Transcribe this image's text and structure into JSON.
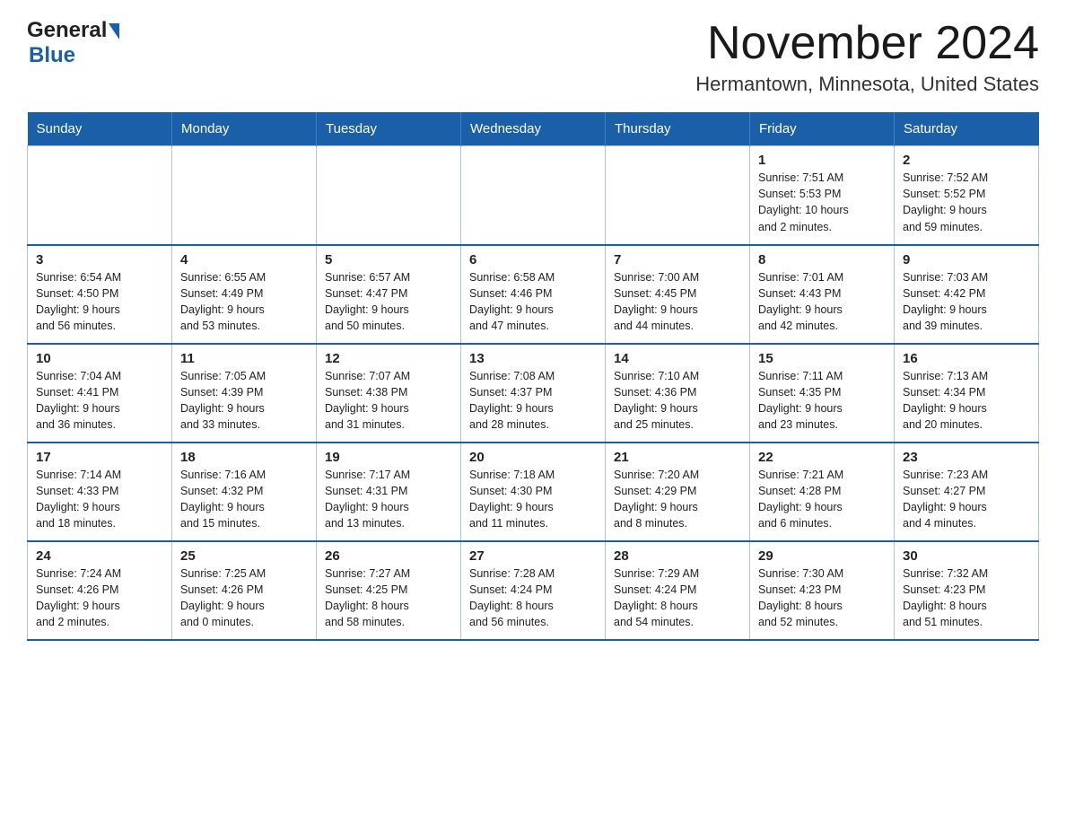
{
  "logo": {
    "general": "General",
    "blue": "Blue"
  },
  "title": "November 2024",
  "location": "Hermantown, Minnesota, United States",
  "days_of_week": [
    "Sunday",
    "Monday",
    "Tuesday",
    "Wednesday",
    "Thursday",
    "Friday",
    "Saturday"
  ],
  "weeks": [
    [
      {
        "day": "",
        "info": ""
      },
      {
        "day": "",
        "info": ""
      },
      {
        "day": "",
        "info": ""
      },
      {
        "day": "",
        "info": ""
      },
      {
        "day": "",
        "info": ""
      },
      {
        "day": "1",
        "info": "Sunrise: 7:51 AM\nSunset: 5:53 PM\nDaylight: 10 hours\nand 2 minutes."
      },
      {
        "day": "2",
        "info": "Sunrise: 7:52 AM\nSunset: 5:52 PM\nDaylight: 9 hours\nand 59 minutes."
      }
    ],
    [
      {
        "day": "3",
        "info": "Sunrise: 6:54 AM\nSunset: 4:50 PM\nDaylight: 9 hours\nand 56 minutes."
      },
      {
        "day": "4",
        "info": "Sunrise: 6:55 AM\nSunset: 4:49 PM\nDaylight: 9 hours\nand 53 minutes."
      },
      {
        "day": "5",
        "info": "Sunrise: 6:57 AM\nSunset: 4:47 PM\nDaylight: 9 hours\nand 50 minutes."
      },
      {
        "day": "6",
        "info": "Sunrise: 6:58 AM\nSunset: 4:46 PM\nDaylight: 9 hours\nand 47 minutes."
      },
      {
        "day": "7",
        "info": "Sunrise: 7:00 AM\nSunset: 4:45 PM\nDaylight: 9 hours\nand 44 minutes."
      },
      {
        "day": "8",
        "info": "Sunrise: 7:01 AM\nSunset: 4:43 PM\nDaylight: 9 hours\nand 42 minutes."
      },
      {
        "day": "9",
        "info": "Sunrise: 7:03 AM\nSunset: 4:42 PM\nDaylight: 9 hours\nand 39 minutes."
      }
    ],
    [
      {
        "day": "10",
        "info": "Sunrise: 7:04 AM\nSunset: 4:41 PM\nDaylight: 9 hours\nand 36 minutes."
      },
      {
        "day": "11",
        "info": "Sunrise: 7:05 AM\nSunset: 4:39 PM\nDaylight: 9 hours\nand 33 minutes."
      },
      {
        "day": "12",
        "info": "Sunrise: 7:07 AM\nSunset: 4:38 PM\nDaylight: 9 hours\nand 31 minutes."
      },
      {
        "day": "13",
        "info": "Sunrise: 7:08 AM\nSunset: 4:37 PM\nDaylight: 9 hours\nand 28 minutes."
      },
      {
        "day": "14",
        "info": "Sunrise: 7:10 AM\nSunset: 4:36 PM\nDaylight: 9 hours\nand 25 minutes."
      },
      {
        "day": "15",
        "info": "Sunrise: 7:11 AM\nSunset: 4:35 PM\nDaylight: 9 hours\nand 23 minutes."
      },
      {
        "day": "16",
        "info": "Sunrise: 7:13 AM\nSunset: 4:34 PM\nDaylight: 9 hours\nand 20 minutes."
      }
    ],
    [
      {
        "day": "17",
        "info": "Sunrise: 7:14 AM\nSunset: 4:33 PM\nDaylight: 9 hours\nand 18 minutes."
      },
      {
        "day": "18",
        "info": "Sunrise: 7:16 AM\nSunset: 4:32 PM\nDaylight: 9 hours\nand 15 minutes."
      },
      {
        "day": "19",
        "info": "Sunrise: 7:17 AM\nSunset: 4:31 PM\nDaylight: 9 hours\nand 13 minutes."
      },
      {
        "day": "20",
        "info": "Sunrise: 7:18 AM\nSunset: 4:30 PM\nDaylight: 9 hours\nand 11 minutes."
      },
      {
        "day": "21",
        "info": "Sunrise: 7:20 AM\nSunset: 4:29 PM\nDaylight: 9 hours\nand 8 minutes."
      },
      {
        "day": "22",
        "info": "Sunrise: 7:21 AM\nSunset: 4:28 PM\nDaylight: 9 hours\nand 6 minutes."
      },
      {
        "day": "23",
        "info": "Sunrise: 7:23 AM\nSunset: 4:27 PM\nDaylight: 9 hours\nand 4 minutes."
      }
    ],
    [
      {
        "day": "24",
        "info": "Sunrise: 7:24 AM\nSunset: 4:26 PM\nDaylight: 9 hours\nand 2 minutes."
      },
      {
        "day": "25",
        "info": "Sunrise: 7:25 AM\nSunset: 4:26 PM\nDaylight: 9 hours\nand 0 minutes."
      },
      {
        "day": "26",
        "info": "Sunrise: 7:27 AM\nSunset: 4:25 PM\nDaylight: 8 hours\nand 58 minutes."
      },
      {
        "day": "27",
        "info": "Sunrise: 7:28 AM\nSunset: 4:24 PM\nDaylight: 8 hours\nand 56 minutes."
      },
      {
        "day": "28",
        "info": "Sunrise: 7:29 AM\nSunset: 4:24 PM\nDaylight: 8 hours\nand 54 minutes."
      },
      {
        "day": "29",
        "info": "Sunrise: 7:30 AM\nSunset: 4:23 PM\nDaylight: 8 hours\nand 52 minutes."
      },
      {
        "day": "30",
        "info": "Sunrise: 7:32 AM\nSunset: 4:23 PM\nDaylight: 8 hours\nand 51 minutes."
      }
    ]
  ]
}
